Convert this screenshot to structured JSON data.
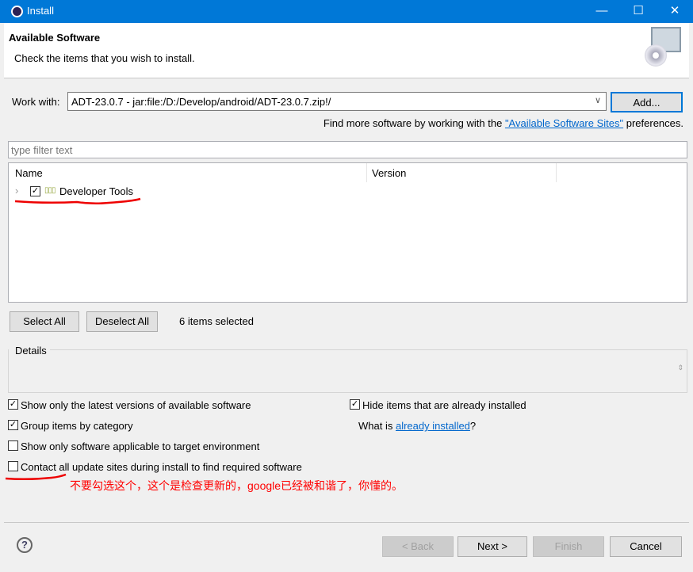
{
  "window": {
    "title": "Install"
  },
  "header": {
    "title": "Available Software",
    "subtitle": "Check the items that you wish to install."
  },
  "work_with": {
    "label": "Work with:",
    "value": "ADT-23.0.7 - jar:file:/D:/Develop/android/ADT-23.0.7.zip!/",
    "add_label": "Add..."
  },
  "find_more": {
    "prefix": "Find more software by working with the ",
    "link": "\"Available Software Sites\"",
    "suffix": " preferences."
  },
  "filter": {
    "placeholder": "type filter text"
  },
  "table": {
    "columns": [
      "Name",
      "Version"
    ],
    "rows": [
      {
        "name": "Developer Tools",
        "checked": true
      }
    ]
  },
  "selection": {
    "select_all": "Select All",
    "deselect_all": "Deselect All",
    "status": "6 items selected"
  },
  "details": {
    "label": "Details"
  },
  "options": {
    "latest": {
      "label": "Show only the latest versions of available software",
      "checked": true
    },
    "hide_installed": {
      "label": "Hide items that are already installed",
      "checked": true
    },
    "group": {
      "label": "Group items by category",
      "checked": true
    },
    "what_is_prefix": "What is ",
    "what_is_link": "already installed",
    "what_is_suffix": "?",
    "applicable": {
      "label": "Show only software applicable to target environment",
      "checked": false
    },
    "contact": {
      "label": "Contact all update sites during install to find required software",
      "checked": false
    }
  },
  "annotation": "不要勾选这个，这个是检查更新的，google已经被和谐了，你懂的。",
  "footer": {
    "back": "< Back",
    "next": "Next >",
    "finish": "Finish",
    "cancel": "Cancel"
  },
  "colors": {
    "accent": "#0078d7",
    "annotation": "#ff0000",
    "link": "#0066cc"
  }
}
